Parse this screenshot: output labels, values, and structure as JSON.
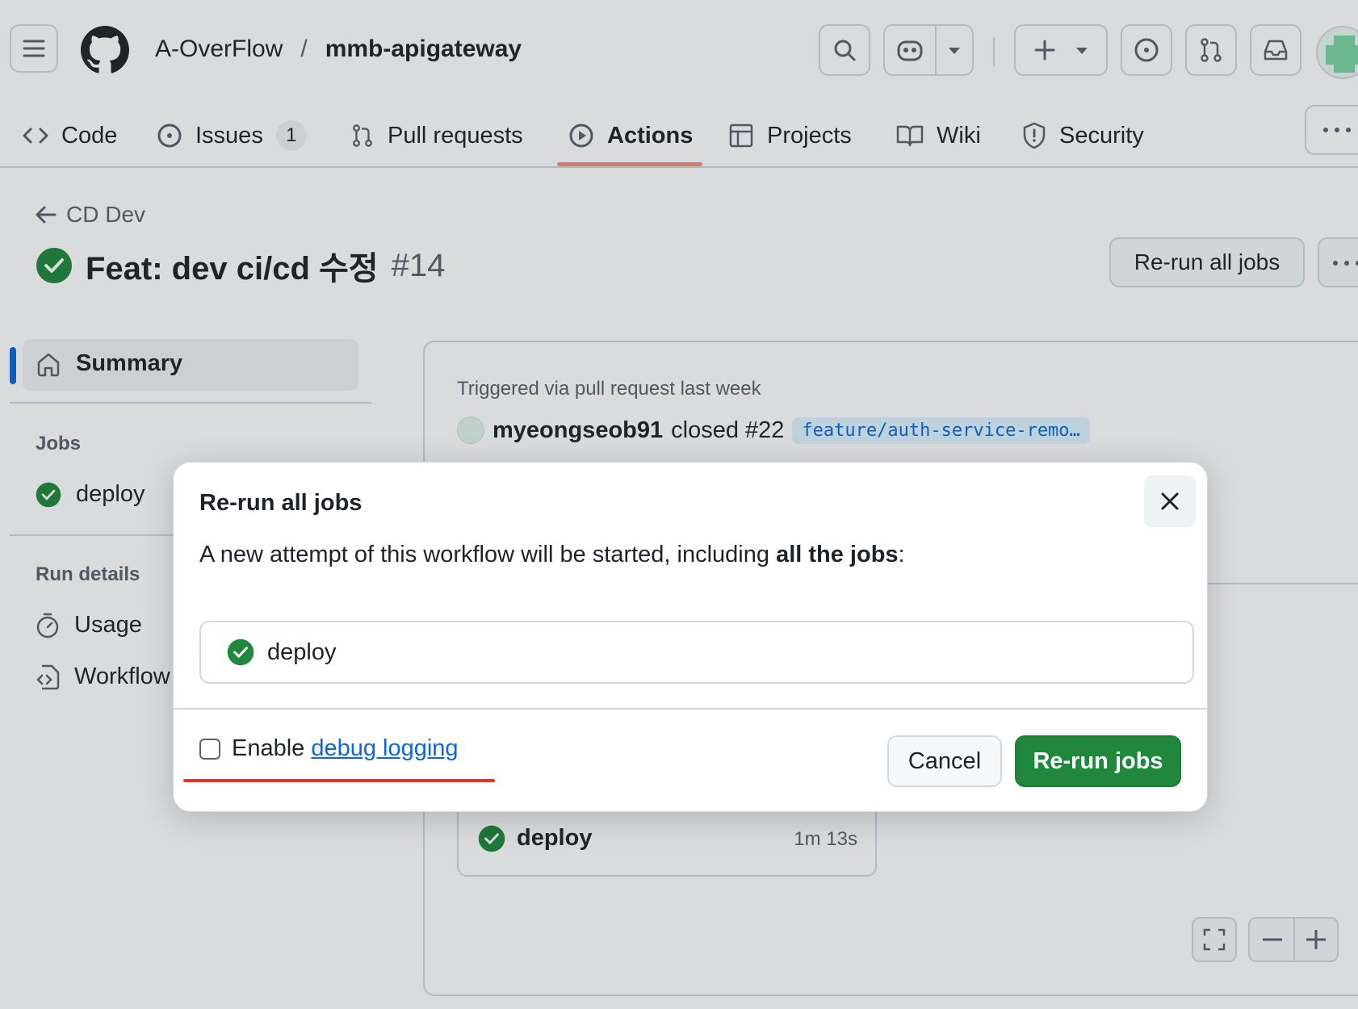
{
  "header": {
    "owner": "A-OverFlow",
    "separator": "/",
    "repo": "mmb-apigateway"
  },
  "tabs": [
    {
      "label": "Code",
      "icon": "code-icon"
    },
    {
      "label": "Issues",
      "icon": "issue-icon",
      "count": "1"
    },
    {
      "label": "Pull requests",
      "icon": "pull-request-icon"
    },
    {
      "label": "Actions",
      "icon": "play-icon",
      "active": true
    },
    {
      "label": "Projects",
      "icon": "table-icon"
    },
    {
      "label": "Wiki",
      "icon": "book-icon"
    },
    {
      "label": "Security",
      "icon": "shield-icon"
    }
  ],
  "run": {
    "back_label": "CD Dev",
    "title": "Feat: dev ci/cd 수정",
    "number": "#14",
    "rerun_all_label": "Re-run all jobs"
  },
  "sidebar": {
    "summary_label": "Summary",
    "jobs_heading": "Jobs",
    "job_label": "deploy",
    "run_details_heading": "Run details",
    "usage_label": "Usage",
    "workflow_label": "Workflow"
  },
  "main": {
    "triggered_text": "Triggered via pull request last week",
    "actor": "myeongseob91",
    "action_text": "closed #22",
    "branch": "feature/auth-service-remo…",
    "job_name": "deploy",
    "job_duration": "1m 13s"
  },
  "dialog": {
    "title": "Re-run all jobs",
    "desc_prefix": "A new attempt of this workflow will be started, including ",
    "desc_bold": "all the jobs",
    "desc_suffix": ":",
    "job_name": "deploy",
    "enable_label": "Enable",
    "debug_link": "debug logging",
    "cancel_label": "Cancel",
    "rerun_label": "Re-run jobs"
  },
  "colors": {
    "success": "#1f883d",
    "link": "#0969da",
    "tab_underline": "#fd8c73",
    "annotation_red": "#e5342b"
  }
}
